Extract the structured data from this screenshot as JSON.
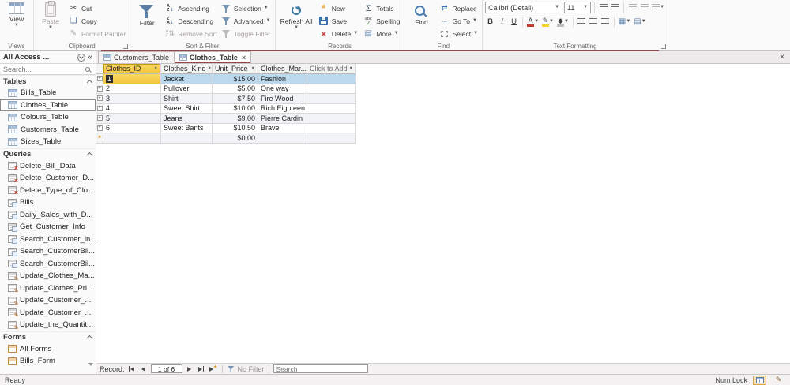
{
  "ribbon": {
    "groups": {
      "views": {
        "label": "Views",
        "view": "View"
      },
      "clipboard": {
        "label": "Clipboard",
        "paste": "Paste",
        "cut": "Cut",
        "copy": "Copy",
        "format_painter": "Format Painter"
      },
      "sort_filter": {
        "label": "Sort & Filter",
        "filter": "Filter",
        "ascending": "Ascending",
        "descending": "Descending",
        "remove_sort": "Remove Sort",
        "selection": "Selection",
        "advanced": "Advanced",
        "toggle_filter": "Toggle Filter"
      },
      "records": {
        "label": "Records",
        "refresh_all": "Refresh All",
        "new": "New",
        "save": "Save",
        "delete": "Delete",
        "totals": "Totals",
        "spelling": "Spelling",
        "more": "More"
      },
      "find": {
        "label": "Find",
        "find": "Find",
        "replace": "Replace",
        "go_to": "Go To",
        "select": "Select"
      },
      "text_formatting": {
        "label": "Text Formatting",
        "font_name": "Calibri (Detail)",
        "font_size": "11"
      }
    }
  },
  "sidebar": {
    "title": "All Access ...",
    "search_placeholder": "Search...",
    "sections": [
      {
        "label": "Tables",
        "items": [
          {
            "label": "Bills_Table",
            "icon": "table"
          },
          {
            "label": "Clothes_Table",
            "icon": "table",
            "selected": true
          },
          {
            "label": "Colours_Table",
            "icon": "table"
          },
          {
            "label": "Customers_Table",
            "icon": "table"
          },
          {
            "label": "Sizes_Table",
            "icon": "table"
          }
        ]
      },
      {
        "label": "Queries",
        "items": [
          {
            "label": "Delete_Bill_Data",
            "icon": "delete-query"
          },
          {
            "label": "Delete_Customer_D...",
            "icon": "delete-query"
          },
          {
            "label": "Delete_Type_of_Clo...",
            "icon": "delete-query"
          },
          {
            "label": "Bills",
            "icon": "select-query"
          },
          {
            "label": "Daily_Sales_with_D...",
            "icon": "select-query"
          },
          {
            "label": "Get_Customer_Info",
            "icon": "select-query"
          },
          {
            "label": "Search_Customer_in...",
            "icon": "select-query"
          },
          {
            "label": "Search_CustomerBil...",
            "icon": "select-query"
          },
          {
            "label": "Search_CustomerBil...",
            "icon": "select-query"
          },
          {
            "label": "Update_Clothes_Ma...",
            "icon": "update-query"
          },
          {
            "label": "Update_Clothes_Pri...",
            "icon": "update-query"
          },
          {
            "label": "Update_Customer_...",
            "icon": "update-query"
          },
          {
            "label": "Update_Customer_...",
            "icon": "update-query"
          },
          {
            "label": "Update_the_Quantit...",
            "icon": "update-query"
          }
        ]
      },
      {
        "label": "Forms",
        "items": [
          {
            "label": "All Forms",
            "icon": "form"
          },
          {
            "label": "Bills_Form",
            "icon": "form"
          }
        ]
      }
    ]
  },
  "document_tabs": [
    {
      "label": "Customers_Table",
      "active": false
    },
    {
      "label": "Clothes_Table",
      "active": true
    }
  ],
  "datasheet": {
    "columns": [
      {
        "name": "Clothes_ID",
        "selected": true
      },
      {
        "name": "Clothes_Kind"
      },
      {
        "name": "Unit_Price"
      },
      {
        "name": "Clothes_Mar..."
      },
      {
        "name": "Click to Add",
        "placeholder": true
      }
    ],
    "rows": [
      {
        "id": "1",
        "kind": "Jacket",
        "price": "$15.00",
        "mark": "Fashion",
        "selected": true
      },
      {
        "id": "2",
        "kind": "Pullover",
        "price": "$5.00",
        "mark": "One way"
      },
      {
        "id": "3",
        "kind": "Shirt",
        "price": "$7.50",
        "mark": "Fire Wood"
      },
      {
        "id": "4",
        "kind": "Sweet Shirt",
        "price": "$10.00",
        "mark": "Rich Eighteen"
      },
      {
        "id": "5",
        "kind": "Jeans",
        "price": "$9.00",
        "mark": "Pierre Cardin"
      },
      {
        "id": "6",
        "kind": "Sweet Bants",
        "price": "$10.50",
        "mark": "Brave"
      }
    ],
    "new_row": {
      "price": "$0.00"
    }
  },
  "record_navigation": {
    "label": "Record:",
    "position": "1 of 6",
    "filter_status": "No Filter",
    "search_placeholder": "Search"
  },
  "status_bar": {
    "left": "Ready",
    "num_lock": "Num Lock"
  },
  "colors": {
    "accent_maroon": "#8E4A4D",
    "selected_header": "#F2C53D",
    "selected_row": "#BCD8EC"
  }
}
